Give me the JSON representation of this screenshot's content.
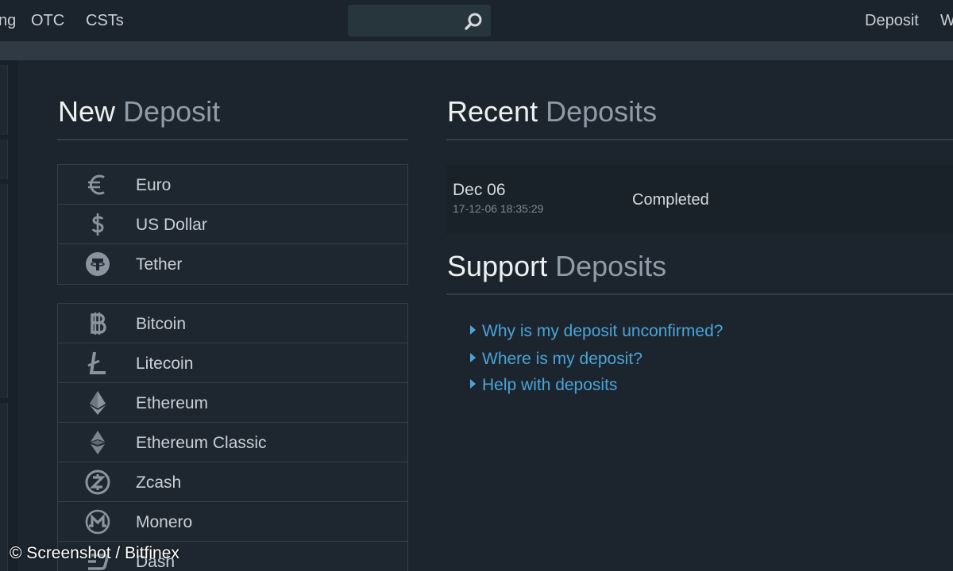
{
  "nav": {
    "items_left": [
      "ng",
      "OTC",
      "CSTs"
    ],
    "items_right": [
      "Deposit",
      "W"
    ]
  },
  "new_deposit": {
    "title_strong": "New",
    "title_muted": "Deposit",
    "fiat": [
      {
        "label": "Euro",
        "icon": "euro-icon"
      },
      {
        "label": "US Dollar",
        "icon": "dollar-icon"
      },
      {
        "label": "Tether",
        "icon": "tether-icon"
      }
    ],
    "crypto": [
      {
        "label": "Bitcoin",
        "icon": "bitcoin-icon"
      },
      {
        "label": "Litecoin",
        "icon": "litecoin-icon"
      },
      {
        "label": "Ethereum",
        "icon": "ethereum-icon"
      },
      {
        "label": "Ethereum Classic",
        "icon": "ethereum-classic-icon"
      },
      {
        "label": "Zcash",
        "icon": "zcash-icon"
      },
      {
        "label": "Monero",
        "icon": "monero-icon"
      },
      {
        "label": "Dash",
        "icon": "dash-icon"
      }
    ]
  },
  "recent_deposits": {
    "title_strong": "Recent",
    "title_muted": "Deposits",
    "rows": [
      {
        "date": "Dec 06",
        "timestamp": "17-12-06 18:35:29",
        "status": "Completed"
      }
    ]
  },
  "support": {
    "title_strong": "Support",
    "title_muted": "Deposits",
    "links": [
      "Why is my deposit unconfirmed?",
      "Where is my deposit?",
      "Help with deposits"
    ]
  },
  "credit": "© Screenshot / Bitfinex",
  "colors": {
    "background": "#1c252e",
    "link": "#4aa4d8",
    "icon": "#8a949e"
  }
}
